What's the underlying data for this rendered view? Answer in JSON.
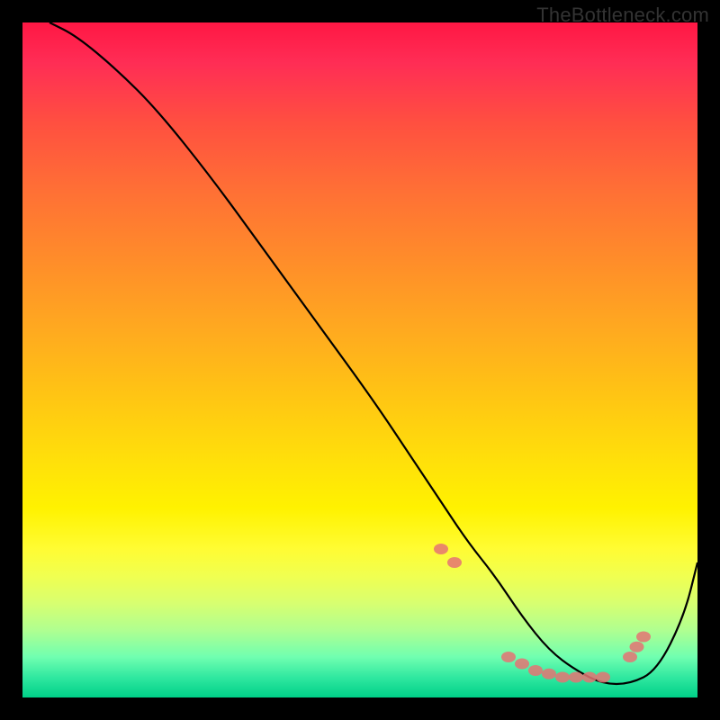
{
  "watermark": "TheBottleneck.com",
  "chart_data": {
    "type": "line",
    "title": "",
    "xlabel": "",
    "ylabel": "",
    "xlim": [
      0,
      100
    ],
    "ylim": [
      0,
      100
    ],
    "series": [
      {
        "name": "bottleneck-curve",
        "x": [
          4,
          8,
          14,
          20,
          28,
          36,
          44,
          52,
          58,
          62,
          66,
          70,
          74,
          78,
          82,
          86,
          90,
          94,
          98,
          100
        ],
        "y": [
          100,
          98,
          93,
          87,
          77,
          66,
          55,
          44,
          35,
          29,
          23,
          18,
          12,
          7,
          4,
          2,
          2,
          4,
          12,
          20
        ]
      }
    ],
    "markers": {
      "name": "highlight-dots",
      "x": [
        62,
        64,
        72,
        74,
        76,
        78,
        80,
        82,
        84,
        86,
        90,
        91,
        92
      ],
      "y": [
        22,
        20,
        6,
        5,
        4,
        3.5,
        3,
        3,
        3,
        3,
        6,
        7.5,
        9
      ]
    },
    "background_gradient": {
      "stops": [
        {
          "pos": 0,
          "color": "#ff1744"
        },
        {
          "pos": 50,
          "color": "#ffc800"
        },
        {
          "pos": 80,
          "color": "#fff200"
        },
        {
          "pos": 100,
          "color": "#00d088"
        }
      ]
    }
  }
}
